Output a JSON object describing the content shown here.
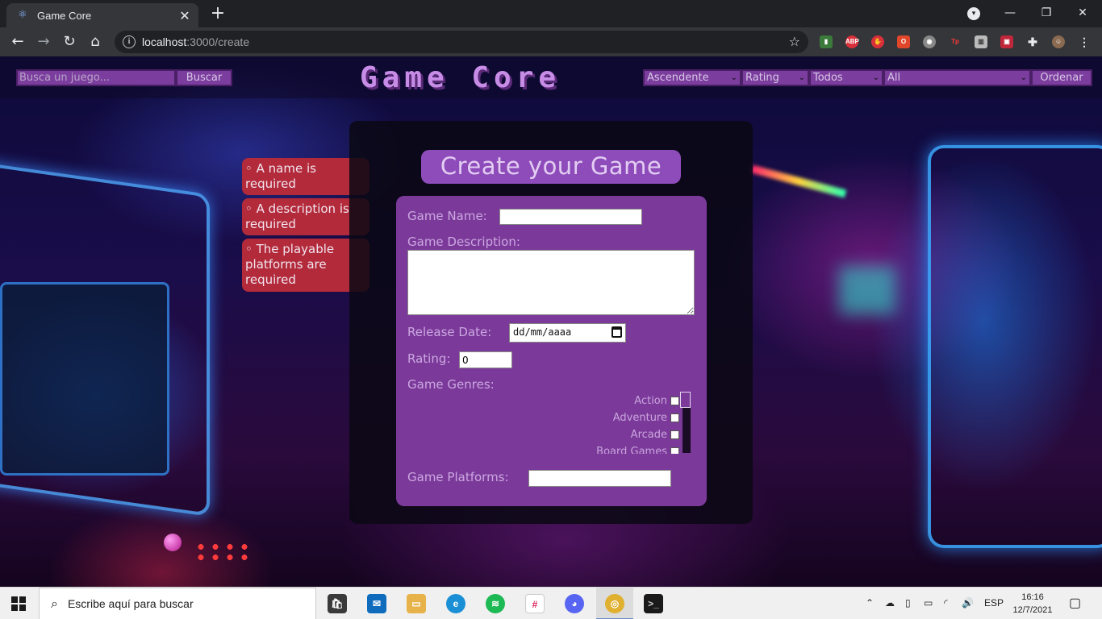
{
  "browser": {
    "tab_title": "Game Core",
    "url_host": "localhost",
    "url_path": ":3000/create",
    "extensions": [
      "ABP",
      "Tp"
    ]
  },
  "header": {
    "search_placeholder": "Busca un juego...",
    "search_button": "Buscar",
    "brand": "Game Core",
    "sort_order": "Ascendente",
    "sort_by": "Rating",
    "source_filter": "Todos",
    "genre_filter": "All",
    "order_button": "Ordenar"
  },
  "errors": [
    "◦ A name is required",
    "◦ A description is required",
    "◦ The playable platforms are required"
  ],
  "form": {
    "title": "Create your Game",
    "name_label": "Game Name:",
    "description_label": "Game Description:",
    "release_label": "Release Date:",
    "release_placeholder": "dd/mm/aaaa",
    "rating_label": "Rating:",
    "rating_value": "0",
    "genres_label": "Game Genres:",
    "genres": [
      "Action",
      "Adventure",
      "Arcade",
      "Board Games"
    ],
    "platforms_label": "Game Platforms:"
  },
  "taskbar": {
    "search_text": "Escribe aquí para buscar",
    "language": "ESP",
    "time": "16:16",
    "date": "12/7/2021"
  }
}
